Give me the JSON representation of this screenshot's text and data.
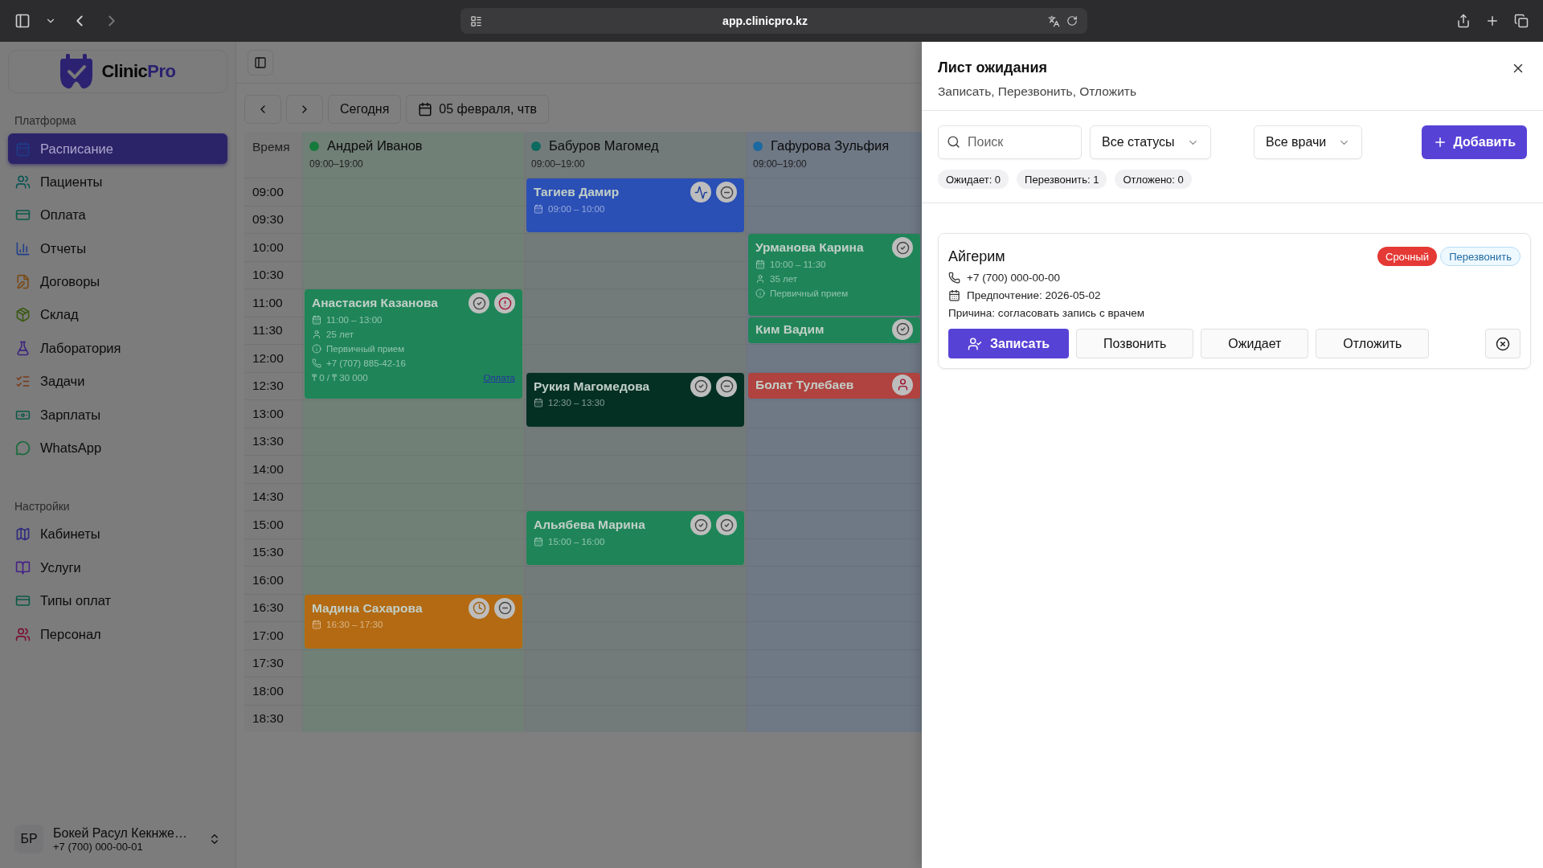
{
  "browser": {
    "url": "app.clinicpro.kz"
  },
  "sidebar": {
    "logo": {
      "main": "Clinic",
      "accent": "Pro"
    },
    "sections": [
      {
        "title": "Платформа",
        "items": [
          {
            "label": "Расписание",
            "selected": true
          },
          {
            "label": "Пациенты",
            "selected": false
          },
          {
            "label": "Оплата",
            "selected": false
          },
          {
            "label": "Отчеты",
            "selected": false
          },
          {
            "label": "Договоры",
            "selected": false
          },
          {
            "label": "Склад",
            "selected": false
          },
          {
            "label": "Лаборатория",
            "selected": false
          },
          {
            "label": "Задачи",
            "selected": false
          },
          {
            "label": "Зарплаты",
            "selected": false
          },
          {
            "label": "WhatsApp",
            "selected": false
          }
        ]
      },
      {
        "title": "Настройки",
        "items": [
          {
            "label": "Кабинеты",
            "selected": false
          },
          {
            "label": "Услуги",
            "selected": false
          },
          {
            "label": "Типы оплат",
            "selected": false
          },
          {
            "label": "Персонал",
            "selected": false
          }
        ]
      }
    ],
    "user": {
      "initials": "БР",
      "name": "Бокей Расул Кекнже…",
      "phone": "+7 (700) 000-00-01"
    }
  },
  "toolbar": {
    "today": "Сегодня",
    "date": "05 февраля, чтв"
  },
  "calendar": {
    "time_header": "Время",
    "times": [
      "09:00",
      "09:30",
      "10:00",
      "10:30",
      "11:00",
      "11:30",
      "12:00",
      "12:30",
      "13:00",
      "13:30",
      "14:00",
      "14:30",
      "15:00",
      "15:30",
      "16:00",
      "16:30",
      "17:00",
      "17:30",
      "18:00",
      "18:30"
    ],
    "doctors": [
      {
        "name": "Андрей Иванов",
        "hours": "09:00–19:00",
        "color": "#167a3d",
        "appointments": [
          {
            "name": "Анастасия Казанова",
            "time": "11:00 – 13:00",
            "color": "#1f8558",
            "status_icons": [
              {
                "kind": "check"
              },
              {
                "kind": "alert"
              }
            ],
            "details": [
              {
                "kind": "age",
                "text": "25 лет"
              },
              {
                "kind": "service",
                "text": "Первичный прием"
              },
              {
                "kind": "phone",
                "text": "+7 (707) 885-42-16"
              }
            ],
            "payment": "₸ 0 / ₸ 30 000",
            "payment_link": "Оплата"
          },
          {
            "name": "Мадина Сахарова",
            "time": "16:30 – 17:30",
            "color": "#b36a12",
            "status_icons": [
              {
                "kind": "clock"
              },
              {
                "kind": "minus"
              }
            ]
          }
        ]
      },
      {
        "name": "Бабуров Магомед",
        "hours": "09:00–19:00",
        "color": "#0c6a60",
        "appointments": [
          {
            "name": "Тагиев Дамир",
            "time": "09:00 – 10:00",
            "color": "#2a4fb5",
            "status_icons": [
              {
                "kind": "activity"
              },
              {
                "kind": "minus"
              }
            ]
          },
          {
            "name": "Рукия Магомедова",
            "time": "12:30 – 13:30",
            "color": "#043024",
            "status_icons": [
              {
                "kind": "check"
              },
              {
                "kind": "minus"
              }
            ]
          },
          {
            "name": "Альябева Марина",
            "time": "15:00 – 16:00",
            "color": "#1f8558",
            "status_icons": [
              {
                "kind": "check"
              },
              {
                "kind": "check"
              }
            ]
          }
        ]
      },
      {
        "name": "Гафурова Зульфия",
        "hours": "09:00–19:00",
        "color": "#1a69a0",
        "appointments": [
          {
            "name": "Урманова Карина",
            "time": "10:00 – 11:30",
            "color": "#1f8558",
            "status_icons": [
              {
                "kind": "check"
              }
            ],
            "details": [
              {
                "kind": "age",
                "text": "35 лет"
              },
              {
                "kind": "service",
                "text": "Первичный прием"
              }
            ]
          },
          {
            "name": "Ким Вадим",
            "color": "#1f8558",
            "status_icons": [
              {
                "kind": "check"
              }
            ]
          },
          {
            "name": "Болат Тулебаев",
            "color": "#b0423f",
            "status_icons": [
              {
                "kind": "user"
              }
            ]
          }
        ]
      }
    ]
  },
  "waitlist": {
    "title": "Лист ожидания",
    "subtitle": "Записать, Перезвонить, Отложить",
    "search": {
      "placeholder": "Поиск"
    },
    "filters": [
      "Все статусы",
      "Все врачи"
    ],
    "add_button": "Добавить",
    "counters": [
      "Ожидает: 0",
      "Перезвонить: 1",
      "Отложено: 0"
    ],
    "entries": [
      {
        "name": "Айгерим",
        "tags": [
          {
            "kind": "urgent",
            "label": "Срочный"
          },
          {
            "kind": "callback",
            "label": "Перезвонить"
          }
        ],
        "phone": "+7 (700) 000-00-00",
        "preference": "Предпочтение: 2026-05-02",
        "reason": "Причина: согласовать запись с врачем",
        "actions": [
          {
            "kind": "primary",
            "label": "Записать"
          },
          {
            "kind": "default",
            "label": "Позвонить"
          },
          {
            "kind": "default",
            "label": "Ожидает"
          },
          {
            "kind": "default",
            "label": "Отложить"
          }
        ]
      }
    ]
  }
}
